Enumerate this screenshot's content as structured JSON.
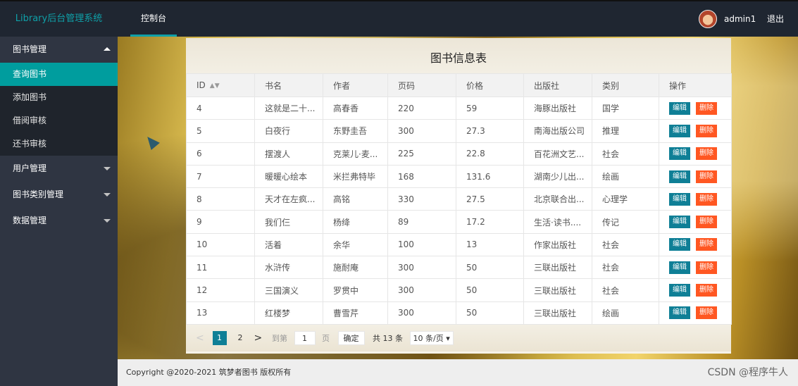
{
  "header": {
    "logo": "Library后台管理系统",
    "nav_item": "控制台",
    "username": "admin1",
    "logout": "退出"
  },
  "sidebar": {
    "groups": [
      {
        "label": "图书管理",
        "expanded": true,
        "items": [
          "查询图书",
          "添加图书",
          "借阅审核",
          "还书审核"
        ]
      },
      {
        "label": "用户管理"
      },
      {
        "label": "图书类别管理"
      },
      {
        "label": "数据管理"
      }
    ]
  },
  "table": {
    "title": "图书信息表",
    "columns": [
      "ID",
      "书名",
      "作者",
      "页码",
      "价格",
      "出版社",
      "类别",
      "操作"
    ],
    "rows": [
      [
        "4",
        "这就是二十...",
        "高春香",
        "220",
        "59",
        "海豚出版社",
        "国学"
      ],
      [
        "5",
        "白夜行",
        "东野圭吾",
        "300",
        "27.3",
        "南海出版公司",
        "推理"
      ],
      [
        "6",
        "摆渡人",
        "克莱儿·麦...",
        "225",
        "22.8",
        "百花洲文艺...",
        "社会"
      ],
      [
        "7",
        "暖暖心绘本",
        "米拦弗特毕",
        "168",
        "131.6",
        "湖南少儿出...",
        "绘画"
      ],
      [
        "8",
        "天才在左疯...",
        "高铭",
        "330",
        "27.5",
        "北京联合出...",
        "心理学"
      ],
      [
        "9",
        "我们仨",
        "杨绛",
        "89",
        "17.2",
        "生活·读书....",
        "传记"
      ],
      [
        "10",
        "活着",
        "余华",
        "100",
        "13",
        "作家出版社",
        "社会"
      ],
      [
        "11",
        "水浒传",
        "施耐庵",
        "300",
        "50",
        "三联出版社",
        "社会"
      ],
      [
        "12",
        "三国演义",
        "罗贯中",
        "300",
        "50",
        "三联出版社",
        "社会"
      ],
      [
        "13",
        "红楼梦",
        "曹雪芹",
        "300",
        "50",
        "三联出版社",
        "绘画"
      ]
    ],
    "edit_label": "编辑",
    "delete_label": "删除"
  },
  "pagination": {
    "prev": "<",
    "pages": [
      "1",
      "2"
    ],
    "next": ">",
    "goto_label": "到第",
    "goto_value": "1",
    "page_label": "页",
    "confirm_label": "确定",
    "total_label": "共 13 条",
    "page_size": "10 条/页 ▾"
  },
  "footer": {
    "copyright": "Copyright @2020-2021 筑梦者图书 版权所有",
    "watermark": "CSDN @程序牛人"
  },
  "colors": {
    "accent": "#009d9e",
    "edit": "#0f7f96",
    "delete": "#ff5722",
    "sidebar": "#2f3542",
    "header": "#1f2631"
  }
}
